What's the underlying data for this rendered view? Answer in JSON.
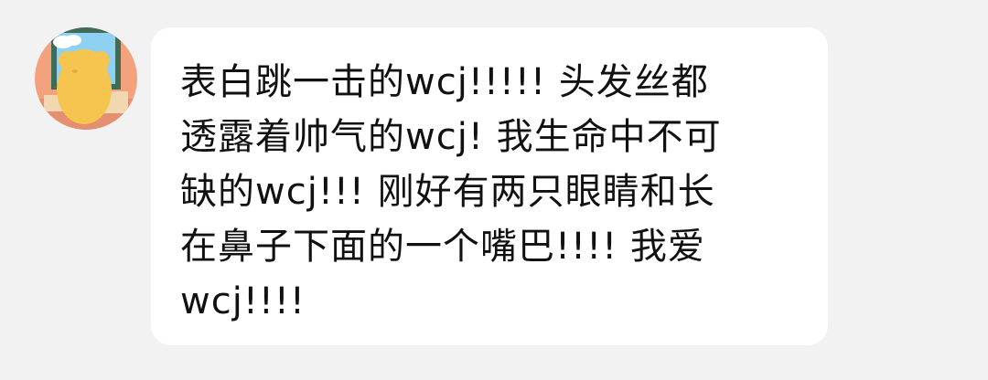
{
  "chat": {
    "message": {
      "text": "表白跳一击的wcj!!!!! 头发丝都\n透露着帅气的wcj! 我生命中不可\n缺的wcj!!! 刚好有两只眼睛和长\n在鼻子下面的一个嘴巴!!!! 我爱\nwcj!!!!"
    },
    "avatar": {
      "icon": "bear-avatar-icon",
      "colors": {
        "background": "#f3a27d",
        "window_frame": "#3f6b57",
        "sky": "#8fd1f2",
        "bear": "#f6c54f"
      }
    }
  }
}
